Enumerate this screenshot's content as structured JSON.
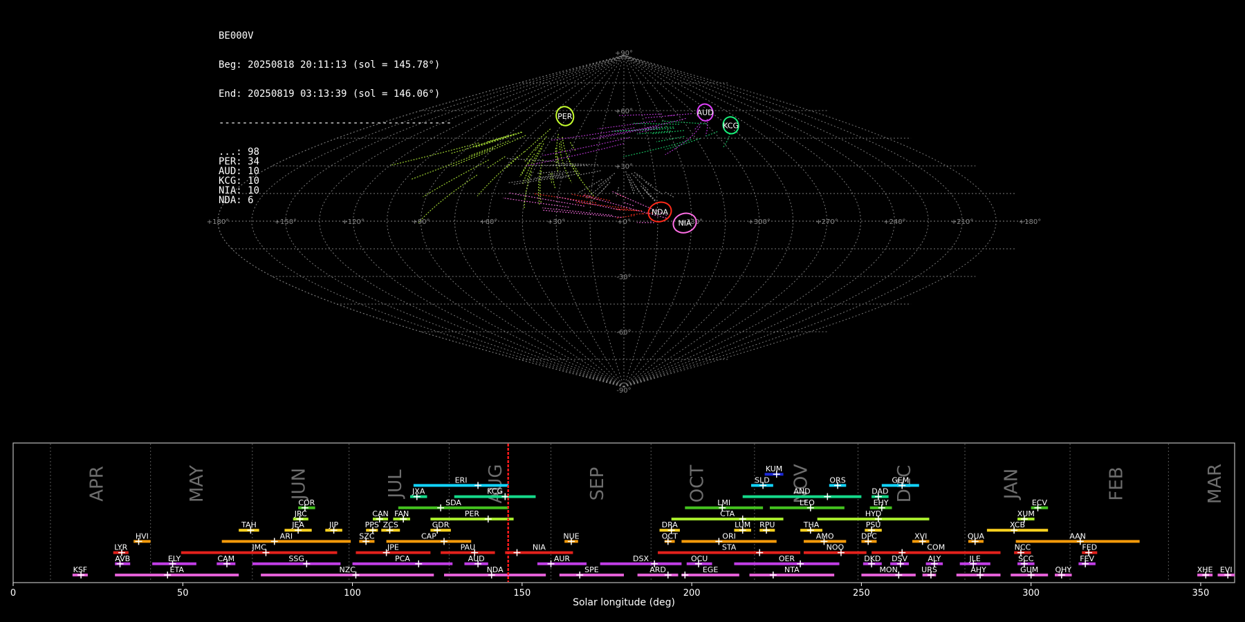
{
  "stats": {
    "station": "BE000V",
    "begin": "Beg: 20250818 20:11:13 (sol = 145.78°)",
    "end": "End: 20250819 03:13:39 (sol = 146.06°)",
    "rule": "----------------------------------------",
    "counts": [
      {
        "code": "...",
        "n": 98
      },
      {
        "code": "PER",
        "n": 34
      },
      {
        "code": "AUD",
        "n": 10
      },
      {
        "code": "KCG",
        "n": 10
      },
      {
        "code": "NIA",
        "n": 10
      },
      {
        "code": "NDA",
        "n": 6
      }
    ]
  },
  "sky_map": {
    "projection": "sinusoidal",
    "lon_labels": [
      "+180°",
      "+150°",
      "+120°",
      "+90°",
      "+60°",
      "+30°",
      "+0°",
      "+330°",
      "+300°",
      "+270°",
      "+240°",
      "+210°",
      "+180°"
    ],
    "lat_labels": [
      "+90°",
      "+60°",
      "+30°",
      "-30°",
      "-60°",
      "-90°"
    ],
    "radiants": [
      {
        "code": "PER",
        "lon": 48,
        "lat": 57,
        "r": 4.5,
        "color": "#c6ff2e"
      },
      {
        "code": "AUD",
        "lon": 290,
        "lat": 59,
        "r": 4.0,
        "color": "#e040fb"
      },
      {
        "code": "KCG",
        "lon": 283,
        "lat": 52,
        "r": 4.0,
        "color": "#18f07a"
      },
      {
        "code": "NDA",
        "lon": 344,
        "lat": 5,
        "r": 4.5,
        "color": "#ff2a1a"
      },
      {
        "code": "NIA",
        "lon": 333,
        "lat": -1,
        "r": 4.5,
        "color": "#ff6ee6"
      }
    ]
  },
  "chart_data": {
    "type": "timeline",
    "xlabel": "Solar longitude (deg)",
    "xlim": [
      0,
      360
    ],
    "xticks": [
      0,
      50,
      100,
      150,
      200,
      250,
      300,
      350
    ],
    "current_sol": 145.9,
    "months": [
      {
        "label": "APR",
        "start": 11.0
      },
      {
        "label": "MAY",
        "start": 40.5
      },
      {
        "label": "JUN",
        "start": 70.5
      },
      {
        "label": "JUL",
        "start": 99.0
      },
      {
        "label": "AUG",
        "start": 128.5
      },
      {
        "label": "SEP",
        "start": 158.5
      },
      {
        "label": "OCT",
        "start": 188.0
      },
      {
        "label": "NOV",
        "start": 218.5
      },
      {
        "label": "DEC",
        "start": 249.0
      },
      {
        "label": "JAN",
        "start": 280.5
      },
      {
        "label": "FEB",
        "start": 311.5
      },
      {
        "label": "MAR",
        "start": 340.5
      }
    ],
    "showers": [
      {
        "code": "KSF",
        "start": 17.5,
        "end": 22,
        "peak": 20,
        "row": 0,
        "color": "#e35fd6"
      },
      {
        "code": "ETA",
        "start": 30,
        "end": 66.5,
        "peak": 45.5,
        "row": 0,
        "color": "#e35fd6"
      },
      {
        "code": "NZC",
        "start": 73,
        "end": 124,
        "peak": 101,
        "row": 0,
        "color": "#e35fd6"
      },
      {
        "code": "NDA",
        "start": 127,
        "end": 157,
        "peak": 141,
        "row": 0,
        "color": "#e35fd6"
      },
      {
        "code": "SPE",
        "start": 161,
        "end": 180,
        "peak": 167,
        "row": 0,
        "color": "#e35fd6"
      },
      {
        "code": "ARD",
        "start": 184,
        "end": 196,
        "peak": 193,
        "row": 0,
        "color": "#e35fd6"
      },
      {
        "code": "EGE",
        "start": 197,
        "end": 214,
        "peak": 198,
        "row": 0,
        "color": "#e35fd6"
      },
      {
        "code": "NTA",
        "start": 217,
        "end": 242,
        "peak": 224,
        "row": 0,
        "color": "#e35fd6"
      },
      {
        "code": "MON",
        "start": 250,
        "end": 266,
        "peak": 261,
        "row": 0,
        "color": "#e35fd6"
      },
      {
        "code": "URS",
        "start": 268,
        "end": 272,
        "peak": 270.5,
        "row": 0,
        "color": "#e35fd6"
      },
      {
        "code": "AHY",
        "start": 278,
        "end": 291,
        "peak": 285,
        "row": 0,
        "color": "#e35fd6"
      },
      {
        "code": "GUM",
        "start": 294,
        "end": 305,
        "peak": 300,
        "row": 0,
        "color": "#e35fd6"
      },
      {
        "code": "QHY",
        "start": 307,
        "end": 312,
        "peak": 309,
        "row": 0,
        "color": "#e35fd6"
      },
      {
        "code": "XHE",
        "start": 349,
        "end": 353.5,
        "peak": 351.5,
        "row": 0,
        "color": "#e35fd6"
      },
      {
        "code": "EVI",
        "start": 355,
        "end": 360,
        "peak": 358,
        "row": 0,
        "color": "#e35fd6"
      },
      {
        "code": "AVB",
        "start": 30,
        "end": 34.5,
        "peak": 31.5,
        "row": 1,
        "color": "#c13ee6"
      },
      {
        "code": "ELY",
        "start": 41,
        "end": 54,
        "peak": 47,
        "row": 1,
        "color": "#c13ee6"
      },
      {
        "code": "CAM",
        "start": 60,
        "end": 65.5,
        "peak": 63,
        "row": 1,
        "color": "#c13ee6"
      },
      {
        "code": "SSG",
        "start": 70.5,
        "end": 96.5,
        "peak": 86.5,
        "row": 1,
        "color": "#c13ee6"
      },
      {
        "code": "PCA",
        "start": 100,
        "end": 129.5,
        "peak": 119.5,
        "row": 1,
        "color": "#c13ee6"
      },
      {
        "code": "AUD",
        "start": 133,
        "end": 140,
        "peak": 137,
        "row": 1,
        "color": "#c13ee6"
      },
      {
        "code": "AUR",
        "start": 154.5,
        "end": 169,
        "peak": 158.5,
        "row": 1,
        "color": "#c13ee6"
      },
      {
        "code": "DSX",
        "start": 173,
        "end": 197,
        "peak": 189,
        "row": 1,
        "color": "#c13ee6"
      },
      {
        "code": "OCU",
        "start": 198.5,
        "end": 206,
        "peak": 202,
        "row": 1,
        "color": "#c13ee6"
      },
      {
        "code": "OER",
        "start": 212.5,
        "end": 243.5,
        "peak": 232,
        "row": 1,
        "color": "#c13ee6"
      },
      {
        "code": "DKD",
        "start": 250.5,
        "end": 256,
        "peak": 253,
        "row": 1,
        "color": "#c13ee6"
      },
      {
        "code": "DSV",
        "start": 258.5,
        "end": 264,
        "peak": 261.5,
        "row": 1,
        "color": "#c13ee6"
      },
      {
        "code": "ALY",
        "start": 269,
        "end": 274,
        "peak": 271.5,
        "row": 1,
        "color": "#c13ee6"
      },
      {
        "code": "JLE",
        "start": 279,
        "end": 288,
        "peak": 283,
        "row": 1,
        "color": "#c13ee6"
      },
      {
        "code": "SCC",
        "start": 296,
        "end": 301,
        "peak": 298,
        "row": 1,
        "color": "#c13ee6"
      },
      {
        "code": "FEV",
        "start": 314,
        "end": 319,
        "peak": 316,
        "row": 1,
        "color": "#c13ee6"
      },
      {
        "code": "LYR",
        "start": 29.5,
        "end": 34,
        "peak": 32,
        "row": 2,
        "color": "#e3211c"
      },
      {
        "code": "JMC",
        "start": 49.5,
        "end": 95.5,
        "peak": 74.5,
        "row": 2,
        "color": "#e3211c"
      },
      {
        "code": "JPE",
        "start": 101,
        "end": 123,
        "peak": 110,
        "row": 2,
        "color": "#e3211c"
      },
      {
        "code": "PAU",
        "start": 126,
        "end": 142,
        "peak": 136,
        "row": 2,
        "color": "#e3211c"
      },
      {
        "code": "NIA",
        "start": 145,
        "end": 165,
        "peak": 148.5,
        "row": 2,
        "color": "#e3211c"
      },
      {
        "code": "STA",
        "start": 190,
        "end": 232,
        "peak": 220,
        "row": 2,
        "color": "#e3211c"
      },
      {
        "code": "NOO",
        "start": 233,
        "end": 251.5,
        "peak": 244,
        "row": 2,
        "color": "#e3211c"
      },
      {
        "code": "COM",
        "start": 253,
        "end": 291,
        "peak": 262,
        "row": 2,
        "color": "#e3211c"
      },
      {
        "code": "NCC",
        "start": 295,
        "end": 300,
        "peak": 297,
        "row": 2,
        "color": "#e3211c"
      },
      {
        "code": "FED",
        "start": 315,
        "end": 319.5,
        "peak": 317,
        "row": 2,
        "color": "#e3211c"
      },
      {
        "code": "HVI",
        "start": 35.5,
        "end": 40.5,
        "peak": 37,
        "row": 3,
        "color": "#f59a0a"
      },
      {
        "code": "ARI",
        "start": 61.5,
        "end": 99.5,
        "peak": 77,
        "row": 3,
        "color": "#f59a0a"
      },
      {
        "code": "SZC",
        "start": 102,
        "end": 106.5,
        "peak": 104,
        "row": 3,
        "color": "#f59a0a"
      },
      {
        "code": "CAP",
        "start": 110,
        "end": 135,
        "peak": 127,
        "row": 3,
        "color": "#f59a0a"
      },
      {
        "code": "NUE",
        "start": 162.5,
        "end": 166.5,
        "peak": 164.5,
        "row": 3,
        "color": "#f59a0a"
      },
      {
        "code": "OCT",
        "start": 192,
        "end": 195,
        "peak": 193,
        "row": 3,
        "color": "#f59a0a"
      },
      {
        "code": "ORI",
        "start": 197,
        "end": 225,
        "peak": 208,
        "row": 3,
        "color": "#f59a0a"
      },
      {
        "code": "AMO",
        "start": 233,
        "end": 245.5,
        "peak": 239,
        "row": 3,
        "color": "#f59a0a"
      },
      {
        "code": "DPC",
        "start": 250,
        "end": 254.5,
        "peak": 252,
        "row": 3,
        "color": "#f59a0a"
      },
      {
        "code": "XVI",
        "start": 265,
        "end": 270,
        "peak": 268,
        "row": 3,
        "color": "#f59a0a"
      },
      {
        "code": "QUA",
        "start": 281.5,
        "end": 286,
        "peak": 283.5,
        "row": 3,
        "color": "#f59a0a"
      },
      {
        "code": "AAN",
        "start": 295.5,
        "end": 332,
        "peak": 314.5,
        "row": 3,
        "color": "#f59a0a"
      },
      {
        "code": "TAH",
        "start": 66.5,
        "end": 72.5,
        "peak": 70,
        "row": 4,
        "color": "#ffd21f"
      },
      {
        "code": "JEA",
        "start": 80,
        "end": 88,
        "peak": 84,
        "row": 4,
        "color": "#ffd21f"
      },
      {
        "code": "JIP",
        "start": 92,
        "end": 97,
        "peak": 94.5,
        "row": 4,
        "color": "#ffd21f"
      },
      {
        "code": "PPS",
        "start": 104,
        "end": 107.5,
        "peak": 106,
        "row": 4,
        "color": "#ffd21f"
      },
      {
        "code": "ZCS",
        "start": 108.5,
        "end": 114,
        "peak": 111,
        "row": 4,
        "color": "#ffd21f"
      },
      {
        "code": "GDR",
        "start": 123,
        "end": 129,
        "peak": 125,
        "row": 4,
        "color": "#ffd21f"
      },
      {
        "code": "DRA",
        "start": 190.5,
        "end": 196.5,
        "peak": 194,
        "row": 4,
        "color": "#ffd21f"
      },
      {
        "code": "LUM",
        "start": 212.5,
        "end": 217.5,
        "peak": 215,
        "row": 4,
        "color": "#ffd21f"
      },
      {
        "code": "RPU",
        "start": 220,
        "end": 224.5,
        "peak": 222,
        "row": 4,
        "color": "#ffd21f"
      },
      {
        "code": "THA",
        "start": 232,
        "end": 238.5,
        "peak": 235,
        "row": 4,
        "color": "#ffd21f"
      },
      {
        "code": "PSU",
        "start": 251,
        "end": 256,
        "peak": 253,
        "row": 4,
        "color": "#ffd21f"
      },
      {
        "code": "XCB",
        "start": 287,
        "end": 305,
        "peak": 295,
        "row": 4,
        "color": "#ffd21f"
      },
      {
        "code": "JRC",
        "start": 82.5,
        "end": 87,
        "peak": 84.5,
        "row": 5,
        "color": "#a6ea2c"
      },
      {
        "code": "CAN",
        "start": 106,
        "end": 110.5,
        "peak": 108,
        "row": 5,
        "color": "#a6ea2c"
      },
      {
        "code": "FAN",
        "start": 112,
        "end": 117,
        "peak": 115,
        "row": 5,
        "color": "#a6ea2c"
      },
      {
        "code": "PER",
        "start": 123,
        "end": 147.5,
        "peak": 140,
        "row": 5,
        "color": "#a6ea2c"
      },
      {
        "code": "CTA",
        "start": 194,
        "end": 227,
        "peak": 215,
        "row": 5,
        "color": "#a6ea2c"
      },
      {
        "code": "HYD",
        "start": 237,
        "end": 270,
        "peak": 255,
        "row": 5,
        "color": "#a6ea2c"
      },
      {
        "code": "XUM",
        "start": 296,
        "end": 301,
        "peak": 298,
        "row": 5,
        "color": "#a6ea2c"
      },
      {
        "code": "COR",
        "start": 84,
        "end": 89,
        "peak": 86,
        "row": 6,
        "color": "#44c21f"
      },
      {
        "code": "SDA",
        "start": 113.5,
        "end": 146,
        "peak": 126,
        "row": 6,
        "color": "#44c21f"
      },
      {
        "code": "LMI",
        "start": 198,
        "end": 221,
        "peak": 209,
        "row": 6,
        "color": "#44c21f"
      },
      {
        "code": "LEO",
        "start": 223,
        "end": 245,
        "peak": 235,
        "row": 6,
        "color": "#44c21f"
      },
      {
        "code": "EHY",
        "start": 252.5,
        "end": 259,
        "peak": 256,
        "row": 6,
        "color": "#44c21f"
      },
      {
        "code": "ECV",
        "start": 300,
        "end": 305,
        "peak": 302,
        "row": 6,
        "color": "#44c21f"
      },
      {
        "code": "JXA",
        "start": 117,
        "end": 122,
        "peak": 119,
        "row": 7,
        "color": "#15d98a"
      },
      {
        "code": "KCG",
        "start": 130,
        "end": 154,
        "peak": 145,
        "row": 7,
        "color": "#15d98a"
      },
      {
        "code": "AND",
        "start": 215,
        "end": 250,
        "peak": 240,
        "row": 7,
        "color": "#15d98a"
      },
      {
        "code": "DAD",
        "start": 253,
        "end": 258,
        "peak": 255,
        "row": 7,
        "color": "#15d98a"
      },
      {
        "code": "ERI",
        "start": 118,
        "end": 146,
        "peak": 137,
        "row": 8,
        "color": "#12d4ff"
      },
      {
        "code": "SLD",
        "start": 217.5,
        "end": 224,
        "peak": 221,
        "row": 8,
        "color": "#12d4ff"
      },
      {
        "code": "ORS",
        "start": 240.5,
        "end": 245.5,
        "peak": 243,
        "row": 8,
        "color": "#12d4ff"
      },
      {
        "code": "GEM",
        "start": 256,
        "end": 267,
        "peak": 262,
        "row": 8,
        "color": "#12d4ff"
      },
      {
        "code": "KUM",
        "start": 221.5,
        "end": 227,
        "peak": 225,
        "row": 9,
        "color": "#1c28d8"
      }
    ]
  }
}
